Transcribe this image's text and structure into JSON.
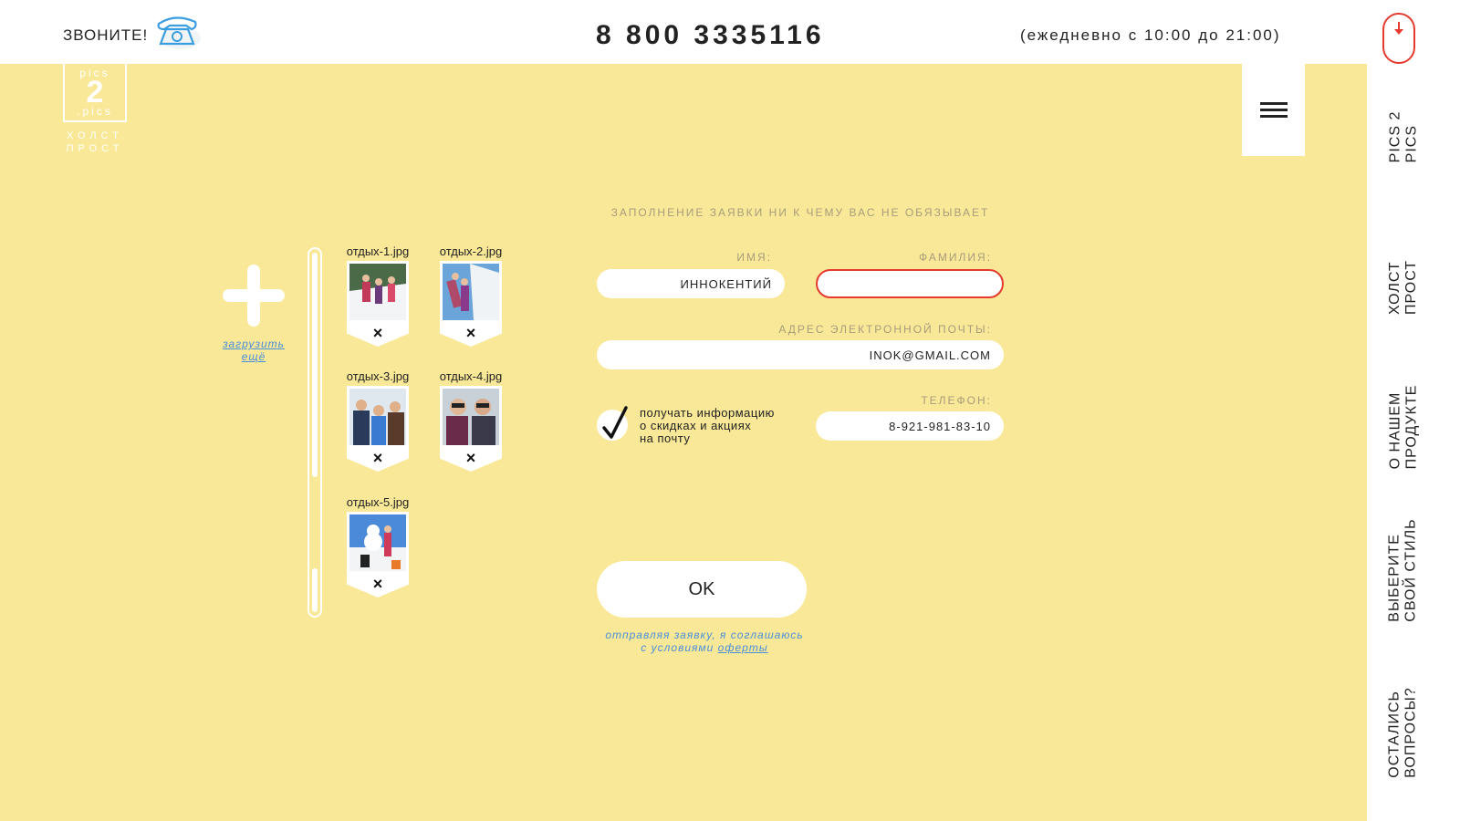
{
  "header": {
    "call_label": "ЗВОНИТЕ!",
    "phone": "8 800 3335116",
    "hours": "(ежедневно с 10:00 до 21:00)"
  },
  "logo": {
    "top_text": "pics",
    "number": "2",
    "bottom_text": ".pics",
    "sub_line1": "ХОЛСТ",
    "sub_line2": "ПРОСТ"
  },
  "sidebar": {
    "items": [
      {
        "label": "PICS 2\nPICS"
      },
      {
        "label": "ХОЛСТ\nПРОСТ"
      },
      {
        "label": "О НАШЕМ\nПРОДУКТЕ"
      },
      {
        "label": "ВЫБЕРИТЕ\nСВОЙ СТИЛЬ"
      },
      {
        "label": "ОСТАЛИСЬ\nВОПРОСЫ?"
      }
    ]
  },
  "upload": {
    "link_line1": "загрузить",
    "link_line2": "ещё"
  },
  "files": [
    {
      "name": "отдых-1.jpg",
      "remove": "×"
    },
    {
      "name": "отдых-2.jpg",
      "remove": "×"
    },
    {
      "name": "отдых-3.jpg",
      "remove": "×"
    },
    {
      "name": "отдых-4.jpg",
      "remove": "×"
    },
    {
      "name": "отдых-5.jpg",
      "remove": "×"
    }
  ],
  "form": {
    "hint": "ЗАПОЛНЕНИЕ ЗАЯВКИ НИ К ЧЕМУ ВАС НЕ ОБЯЗЫВАЕТ",
    "first_name_label": "ИМЯ:",
    "first_name_value": "ИННОКЕНТИЙ",
    "last_name_label": "ФАМИЛИЯ:",
    "last_name_value": "",
    "email_label": "АДРЕС ЭЛЕКТРОННОЙ ПОЧТЫ:",
    "email_value": "INOK@GMAIL.COM",
    "phone_label": "ТЕЛЕФОН:",
    "phone_value": "8-921-981-83-10",
    "subscribe_line1": "получать информацию",
    "subscribe_line2": "о скидках и акциях",
    "subscribe_line3": "на почту",
    "subscribe_checked": true,
    "submit_label": "OK",
    "agree_line1": "отправляя заявку, я соглашаюсь",
    "agree_line2_prefix": "с условиями",
    "agree_link": "оферты"
  },
  "colors": {
    "background": "#f9e897",
    "error": "#e53a2d",
    "link": "#4a8fd8",
    "label": "#a89c7b"
  }
}
